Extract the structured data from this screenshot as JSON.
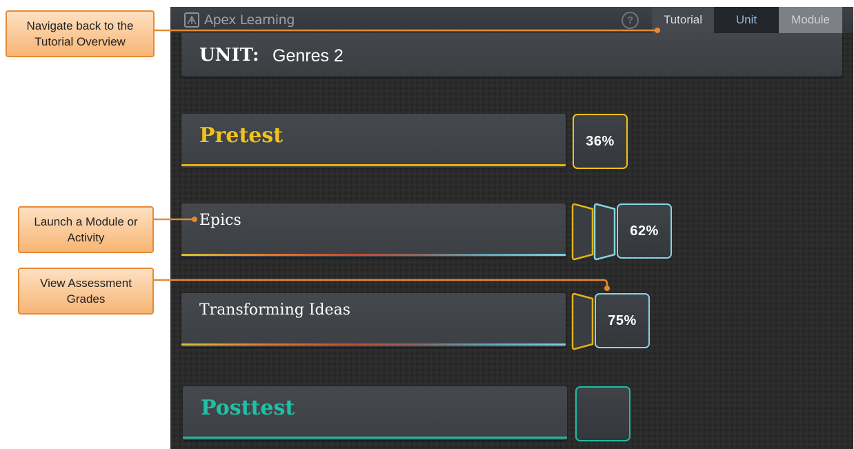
{
  "app": {
    "brand": "Apex Learning",
    "help_icon": "question-circle-icon",
    "tabs": [
      {
        "label": "Tutorial",
        "state": "default"
      },
      {
        "label": "Unit",
        "state": "active"
      },
      {
        "label": "Module",
        "state": "disabled"
      }
    ]
  },
  "unit": {
    "label": "UNIT:",
    "title": "Genres 2"
  },
  "rows": [
    {
      "label": "Pretest",
      "score": "36%",
      "color": "#f1c21a"
    },
    {
      "label": "Epics",
      "score": "62%",
      "color": "#86d5e3"
    },
    {
      "label": "Transforming Ideas",
      "score": "75%",
      "color": "#86d5e3"
    },
    {
      "label": "Posttest",
      "score": "",
      "color": "#1ebca3"
    }
  ],
  "callouts": {
    "nav": "Navigate back to the Tutorial Overview",
    "launch": "Launch a Module or Activity",
    "grades": "View Assessment Grades"
  },
  "colors": {
    "accent_orange": "#e58a34",
    "pretest_yellow": "#f1c21a",
    "module_blue": "#86d5e3",
    "posttest_teal": "#1ebca3"
  }
}
